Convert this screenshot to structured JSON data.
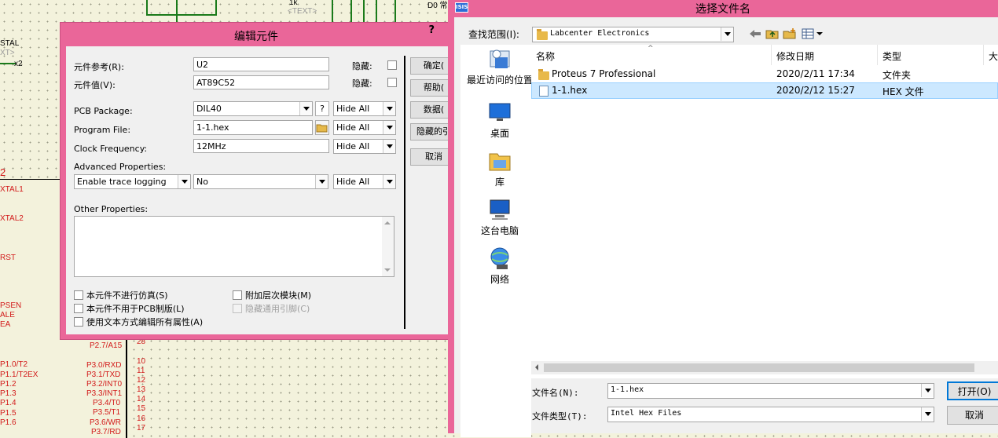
{
  "schematic": {
    "left_labels": [
      "STAL",
      "x2",
      "2",
      "XTAL1",
      "XTAL2",
      "RST",
      "PSEN",
      "ALE",
      "EA",
      "P1.0/T2",
      "P1.1/T2EX",
      "P1.2",
      "P1.3",
      "P1.4",
      "P1.5",
      "P1.6"
    ],
    "top_labels": [
      "1k",
      "<TEXT>",
      "D0 常"
    ],
    "pins": [
      {
        "name": "P2.7/A15",
        "num": "28"
      },
      {
        "name": "P3.0/RXD",
        "num": "10"
      },
      {
        "name": "P3.1/TXD",
        "num": "11"
      },
      {
        "name": "P3.2/INT0",
        "num": "12"
      },
      {
        "name": "P3.3/INT1",
        "num": "13"
      },
      {
        "name": "P3.4/T0",
        "num": "14"
      },
      {
        "name": "P3.5/T1",
        "num": "15"
      },
      {
        "name": "P3.6/WR",
        "num": "16"
      },
      {
        "name": "P3.7/RD",
        "num": "17"
      }
    ]
  },
  "edit_dialog": {
    "title": "编辑元件",
    "help_glyph": "?",
    "component_ref_label": "元件参考(R):",
    "component_ref_value": "U2",
    "component_value_label": "元件值(V):",
    "component_value_value": "AT89C52",
    "hidden_label": "隐藏:",
    "pcb_package_label": "PCB Package:",
    "pcb_package_value": "DIL40",
    "pcb_help": "?",
    "program_file_label": "Program File:",
    "program_file_value": "1-1.hex",
    "clock_label": "Clock Frequency:",
    "clock_value": "12MHz",
    "hide_all": "Hide All",
    "advanced_label": "Advanced Properties:",
    "advanced_prop": "Enable trace logging",
    "advanced_value": "No",
    "other_label": "Other Properties:",
    "checkboxes": [
      "本元件不进行仿真(S)",
      "本元件不用于PCB制版(L)",
      "使用文本方式编辑所有属性(A)",
      "附加层次模块(M)",
      "隐藏通用引脚(C)"
    ],
    "buttons": [
      "确定(",
      "帮助(",
      "数据(",
      "隐藏的引",
      "取消"
    ]
  },
  "file_dialog": {
    "title": "选择文件名",
    "app_icon_text": "ISIS",
    "look_in_label": "查找范围(I):",
    "look_in_value": "Labcenter Electronics",
    "places": [
      "最近访问的位置",
      "桌面",
      "库",
      "这台电脑",
      "网络"
    ],
    "columns": [
      "名称",
      "修改日期",
      "类型",
      "大"
    ],
    "rows": [
      {
        "name": "Proteus 7 Professional",
        "date": "2020/2/11 17:34",
        "type": "文件夹",
        "kind": "folder"
      },
      {
        "name": "1-1.hex",
        "date": "2020/2/12 15:27",
        "type": "HEX 文件",
        "kind": "file"
      }
    ],
    "filename_label": "文件名(N):",
    "filename_value": "1-1.hex",
    "filetype_label": "文件类型(T):",
    "filetype_value": "Intel Hex Files",
    "open_button": "打开(O)",
    "cancel_button": "取消"
  }
}
